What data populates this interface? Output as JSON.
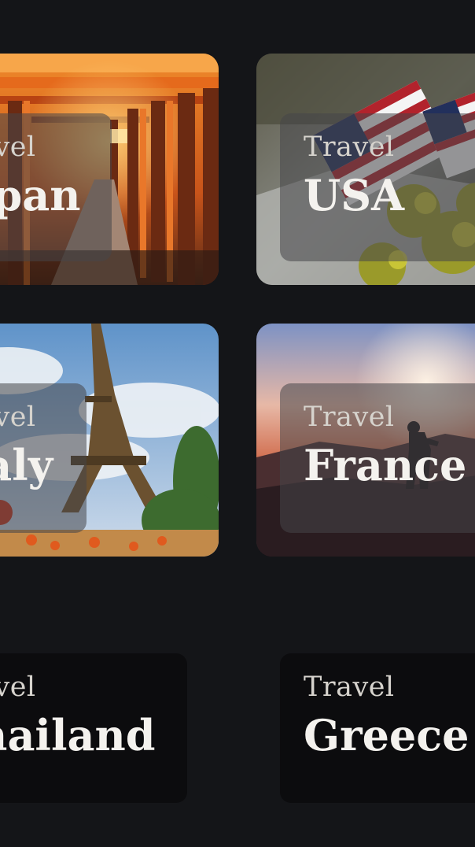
{
  "cards": [
    {
      "small": "Travel",
      "big": "Japan",
      "image": "fushimi-inari-torii-gates"
    },
    {
      "small": "Travel",
      "big": "USA",
      "image": "american-flags"
    },
    {
      "small": "Travel",
      "big": "Italy",
      "image": "eiffel-tower"
    },
    {
      "small": "Travel",
      "big": "France",
      "image": "sunset-silhouette"
    },
    {
      "small": "Travel",
      "big": "Thailand",
      "image": ""
    },
    {
      "small": "Travel",
      "big": "Greece",
      "image": ""
    }
  ],
  "colors": {
    "background": "#141518",
    "glass_overlay": "#464648",
    "solid_card": "#0c0c0e",
    "label_muted": "#d6d3cd",
    "label_strong": "#f4f2ee"
  }
}
